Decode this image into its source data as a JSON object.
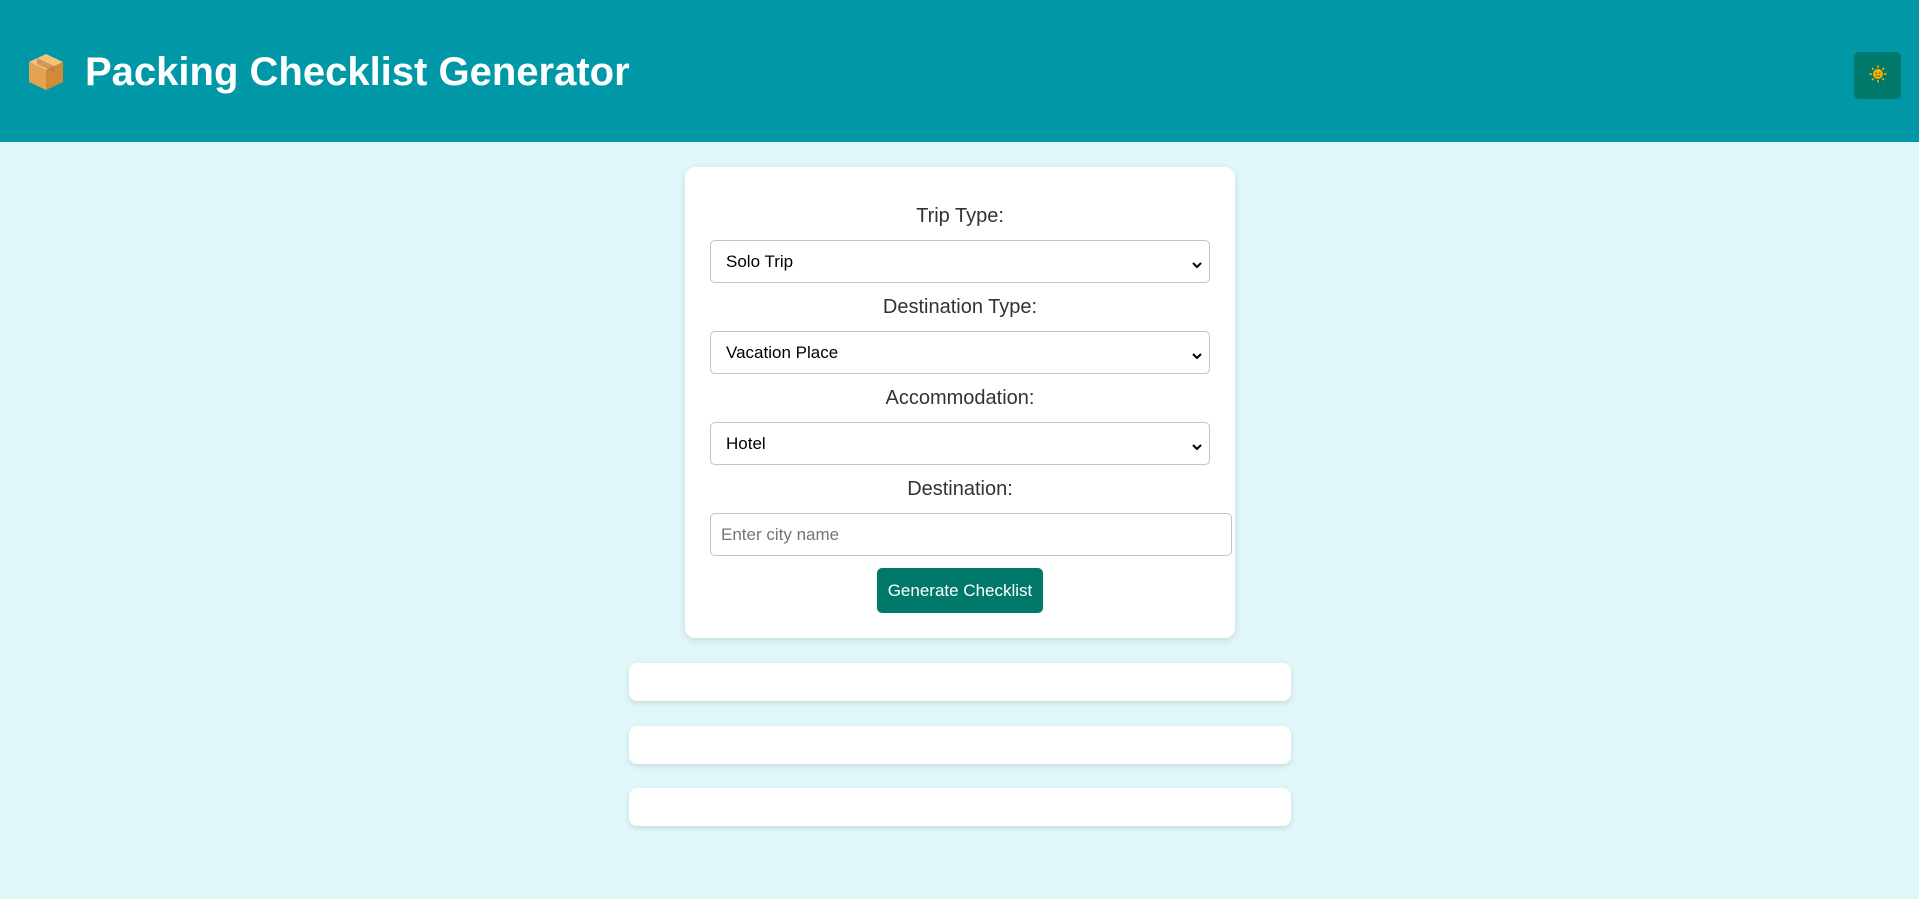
{
  "header": {
    "logo_icon": "package-icon",
    "title": "Packing Checklist Generator",
    "theme_toggle_icon": "sun-face-icon",
    "colors": {
      "background": "#0097a7",
      "toggle": "#00796b"
    }
  },
  "form": {
    "trip_type": {
      "label": "Trip Type:",
      "value": "Solo Trip"
    },
    "destination_type": {
      "label": "Destination Type:",
      "value": "Vacation Place"
    },
    "accommodation": {
      "label": "Accommodation:",
      "value": "Hotel"
    },
    "destination": {
      "label": "Destination:",
      "value": "",
      "placeholder": "Enter city name"
    },
    "generate_label": "Generate Checklist",
    "accent_color": "#00796b"
  },
  "results": {
    "panels": [
      "",
      "",
      ""
    ]
  },
  "page": {
    "background": "#e0f7f9"
  }
}
